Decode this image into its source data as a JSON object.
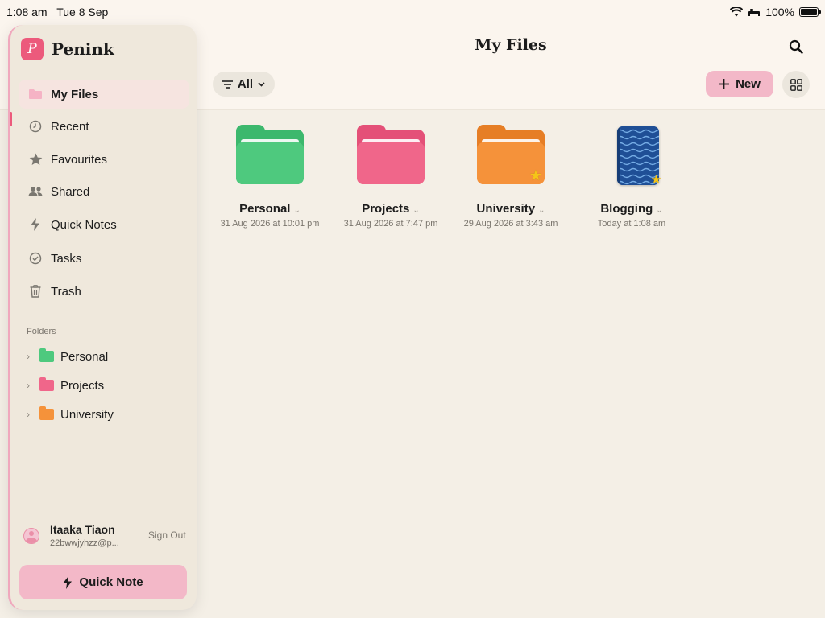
{
  "status_bar": {
    "time": "1:08 am",
    "date": "Tue 8 Sep",
    "battery": "100%"
  },
  "header": {
    "title": "My Files",
    "filter_label": "All",
    "new_label": "New"
  },
  "sidebar": {
    "app_name": "Penink",
    "logo_letter": "P",
    "nav": [
      {
        "label": "My Files",
        "icon": "folder-icon"
      },
      {
        "label": "Recent",
        "icon": "clock-icon"
      },
      {
        "label": "Favourites",
        "icon": "star-icon"
      },
      {
        "label": "Shared",
        "icon": "people-icon"
      },
      {
        "label": "Quick Notes",
        "icon": "bolt-icon"
      },
      {
        "label": "Tasks",
        "icon": "check-circle-icon"
      },
      {
        "label": "Trash",
        "icon": "trash-icon"
      }
    ],
    "folders_label": "Folders",
    "folders": [
      {
        "label": "Personal",
        "color": "#4ec97e"
      },
      {
        "label": "Projects",
        "color": "#f0668a"
      },
      {
        "label": "University",
        "color": "#f5923a"
      }
    ],
    "user": {
      "name": "Itaaka Tiaon",
      "email": "22bwwjyhzz@p...",
      "sign_out": "Sign Out"
    },
    "quick_note_label": "Quick Note"
  },
  "files": [
    {
      "name": "Personal",
      "date": "31 Aug 2026 at 10:01 pm",
      "type": "folder",
      "color": "#4ec97e",
      "starred": false
    },
    {
      "name": "Projects",
      "date": "31 Aug 2026 at 7:47 pm",
      "type": "folder",
      "color": "#f0668a",
      "starred": false
    },
    {
      "name": "University",
      "date": "29 Aug 2026 at 3:43 am",
      "type": "folder",
      "color": "#f5923a",
      "starred": true
    },
    {
      "name": "Blogging",
      "date": "Today at 1:08 am",
      "type": "notebook",
      "color": "#1f4f96",
      "starred": true
    }
  ],
  "colors": {
    "accent": "#ec5a7c",
    "accent_soft": "#f3b8c8",
    "background": "#f4efe6"
  }
}
